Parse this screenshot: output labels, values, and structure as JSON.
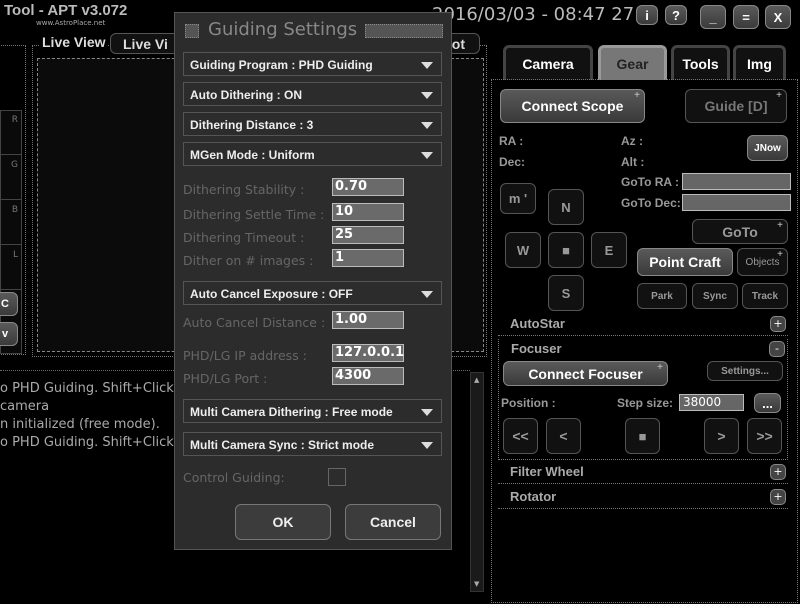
{
  "app": {
    "title": "Tool - APT v3.072",
    "subtitle": "www.AstroPlace.net",
    "datetime": "2016/03/03 - 08:47 27",
    "buttons": {
      "info": "i",
      "help": "?",
      "minimize": "_",
      "maximize": "=",
      "close": "X"
    }
  },
  "live_view": {
    "label": "Live View",
    "tab1": "Live Vi",
    "tab2": "ot"
  },
  "left_panel": {
    "channels": [
      "R",
      "G",
      "B",
      "L"
    ],
    "btn_c": "C",
    "btn_v": "v"
  },
  "log": [
    "o PHD Guiding. Shift+Click",
    "camera",
    "n initialized (free mode).",
    "o PHD Guiding. Shift+Click"
  ],
  "dialog": {
    "title": "Guiding Settings",
    "guiding_program": "Guiding Program : PHD Guiding",
    "auto_dithering": "Auto Dithering : ON",
    "dithering_distance": "Dithering Distance : 3",
    "mgen_mode": "MGen Mode : Uniform",
    "fields": [
      {
        "label": "Dithering Stability :",
        "value": "0.70"
      },
      {
        "label": "Dithering Settle Time :",
        "value": "10"
      },
      {
        "label": "Dithering Timeout :",
        "value": "25"
      },
      {
        "label": "Dither on # images :",
        "value": "1"
      }
    ],
    "auto_cancel": "Auto Cancel Exposure : OFF",
    "auto_cancel_distance": {
      "label": "Auto Cancel Distance :",
      "value": "1.00"
    },
    "ip": {
      "label": "PHD/LG IP address :",
      "value": "127.0.0.1"
    },
    "port": {
      "label": "PHD/LG Port :",
      "value": "4300"
    },
    "multi_dither": "Multi Camera Dithering : Free mode",
    "multi_sync": "Multi Camera Sync : Strict mode",
    "control_guiding": {
      "label": "Control Guiding:",
      "checked": false
    },
    "ok": "OK",
    "cancel": "Cancel"
  },
  "tabs": [
    {
      "label": "Camera"
    },
    {
      "label": "Gear",
      "active": true
    },
    {
      "label": "Tools"
    },
    {
      "label": "Img"
    }
  ],
  "gear": {
    "connect_scope": "Connect Scope",
    "guide": "Guide [D]",
    "ra": "RA :",
    "dec": "Dec:",
    "az": "Az :",
    "alt": "Alt :",
    "jnow": "JNow",
    "goto_ra": "GoTo RA :",
    "goto_dec": "GoTo Dec:",
    "goto_ra_value": "",
    "goto_dec_value": "",
    "m": "m '",
    "n": "N",
    "w": "W",
    "stop": "■",
    "e": "E",
    "s": "S",
    "goto": "GoTo",
    "point_craft": "Point Craft",
    "objects": "Objects",
    "park": "Park",
    "sync": "Sync",
    "track": "Track",
    "autostar": "AutoStar",
    "focuser": "Focuser",
    "connect_focuser": "Connect Focuser",
    "settings": "Settings...",
    "position": "Position :",
    "step_size": "Step size:",
    "step_value": "38000",
    "more": "...",
    "ff_back": "<<",
    "back": "<",
    "fstop": "■",
    "fwd": ">",
    "ff_fwd": ">>",
    "filter_wheel": "Filter Wheel",
    "rotator": "Rotator",
    "expand": "+",
    "collapse": "-"
  }
}
